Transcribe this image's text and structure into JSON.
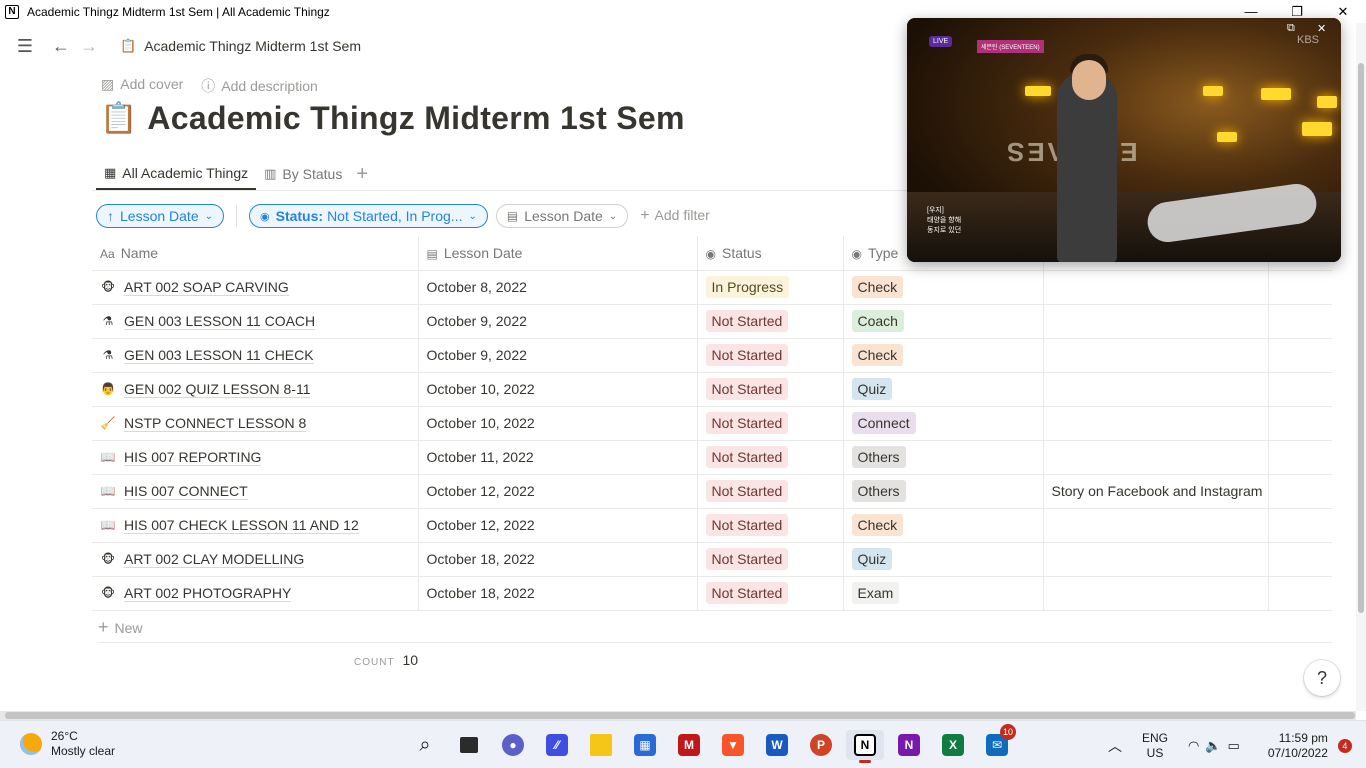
{
  "window": {
    "title": "Academic Thingz Midterm 1st Sem | All Academic Thingz",
    "app_logo": "N"
  },
  "topbar": {
    "breadcrumb": "Academic Thingz Midterm 1st Sem",
    "breadcrumb_icon": "📋"
  },
  "page": {
    "add_cover": "Add cover",
    "add_description": "Add description",
    "icon": "📋",
    "title": "Academic Thingz Midterm 1st Sem"
  },
  "tabs": [
    {
      "label": "All Academic Thingz",
      "icon": "table-icon",
      "active": true
    },
    {
      "label": "By Status",
      "icon": "board-icon",
      "active": false
    }
  ],
  "filters": {
    "sort_label": "Lesson Date",
    "status_key": "Status:",
    "status_value": "Not Started, In Prog...",
    "date_filter": "Lesson Date",
    "add_filter": "Add filter"
  },
  "table": {
    "columns": {
      "name": "Name",
      "date": "Lesson Date",
      "status": "Status",
      "type": "Type"
    },
    "rows": [
      {
        "emoji": "🐵",
        "name": "ART 002 SOAP CARVING",
        "date": "October 8, 2022",
        "status": "In Progress",
        "type": "Check",
        "notes": ""
      },
      {
        "emoji": "⚗",
        "name": "GEN 003 LESSON 11 COACH",
        "date": "October 9, 2022",
        "status": "Not Started",
        "type": "Coach",
        "notes": ""
      },
      {
        "emoji": "⚗",
        "name": "GEN 003 LESSON 11 CHECK",
        "date": "October 9, 2022",
        "status": "Not Started",
        "type": "Check",
        "notes": ""
      },
      {
        "emoji": "👨",
        "name": "GEN 002 QUIZ LESSON 8-11",
        "date": "October 10, 2022",
        "status": "Not Started",
        "type": "Quiz",
        "notes": ""
      },
      {
        "emoji": "🧹",
        "name": "NSTP CONNECT LESSON 8",
        "date": "October 10, 2022",
        "status": "Not Started",
        "type": "Connect",
        "notes": ""
      },
      {
        "emoji": "📖",
        "name": "HIS 007 REPORTING",
        "date": "October 11, 2022",
        "status": "Not Started",
        "type": "Others",
        "notes": ""
      },
      {
        "emoji": "📖",
        "name": "HIS 007 CONNECT",
        "date": "October 12, 2022",
        "status": "Not Started",
        "type": "Others",
        "notes": "Story on Facebook and Instagram"
      },
      {
        "emoji": "📖",
        "name": "HIS 007 CHECK LESSON 11 AND 12",
        "date": "October 12, 2022",
        "status": "Not Started",
        "type": "Check",
        "notes": ""
      },
      {
        "emoji": "🐵",
        "name": "ART 002 CLAY MODELLING",
        "date": "October 18, 2022",
        "status": "Not Started",
        "type": "Quiz",
        "notes": ""
      },
      {
        "emoji": "🐵",
        "name": "ART 002 PHOTOGRAPHY",
        "date": "October 18, 2022",
        "status": "Not Started",
        "type": "Exam",
        "notes": ""
      }
    ]
  },
  "new_row": "New",
  "count": {
    "label": "COUNT",
    "value": "10"
  },
  "help": "?",
  "colors": {
    "in_progress_bg": "#fbf3db",
    "in_progress_fg": "#5a4a1a",
    "not_started_bg": "#fbe4e4",
    "not_started_fg": "#6e3630",
    "check": "#fae3d1",
    "coach": "#dbeddb",
    "quiz": "#d3e5ef",
    "connect": "#e8deee",
    "others": "#e3e2e0",
    "exam": "#f1f1ef"
  },
  "video": {
    "channel": "KBS",
    "badge": "LIVE",
    "artist": "세븐틴 (SEVENTEEN)",
    "caption": [
      "[우지]",
      "태양을 향해",
      "동지로 있던"
    ]
  },
  "taskbar": {
    "temp": "26°C",
    "weather": "Mostly clear",
    "lang": "ENG",
    "region": "US",
    "time": "11:59 pm",
    "date": "07/10/2022",
    "mail_badge": "10",
    "notif_count": "4"
  }
}
